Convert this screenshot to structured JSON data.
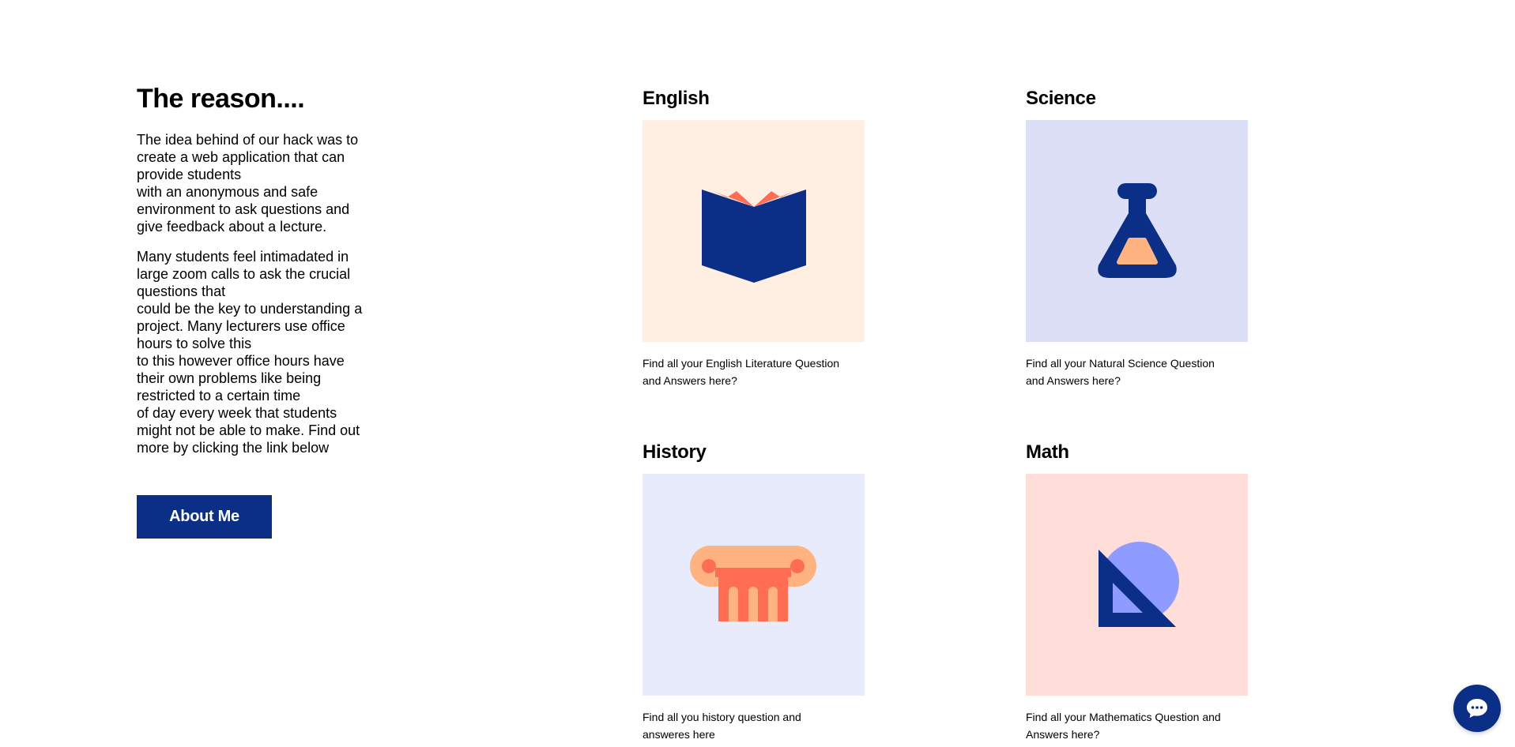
{
  "intro": {
    "heading": "The reason....",
    "paragraph1": "The idea behind of our hack was to\ncreate a web application that can\nprovide students\nwith an anonymous and safe\nenvironment to ask questions and\ngive feedback about a lecture.",
    "paragraph2": "Many students feel intimadated in\nlarge zoom calls to ask the crucial\nquestions that\ncould be the key to understanding a\nproject. Many lecturers use office\nhours to solve this\nto this however office hours have\ntheir own problems like being\nrestricted to a certain time\nof day every week that students\nmight not be able to make. Find out\nmore by clicking the link below",
    "button_label": "About Me"
  },
  "subjects": [
    {
      "title": "English",
      "icon": "book-icon",
      "tile_color": "#ffefe3",
      "description": "Find all your English Literature Question and Answers here?"
    },
    {
      "title": "Science",
      "icon": "flask-icon",
      "tile_color": "#dcdff5",
      "description": "Find all your Natural Science Question and Answers here?"
    },
    {
      "title": "History",
      "icon": "column-icon",
      "tile_color": "#e8ebfb",
      "description": "Find all you history question and answeres here"
    },
    {
      "title": "Math",
      "icon": "set-square-icon",
      "tile_color": "#ffded9",
      "description": "Find all your Mathematics Question and Answers here?"
    }
  ],
  "colors": {
    "brand_navy": "#0b2f86",
    "accent_coral": "#ff6e54",
    "accent_peach": "#ffb380",
    "accent_periwinkle": "#8f9cff"
  },
  "chat": {
    "icon": "chat-bubble-icon"
  }
}
